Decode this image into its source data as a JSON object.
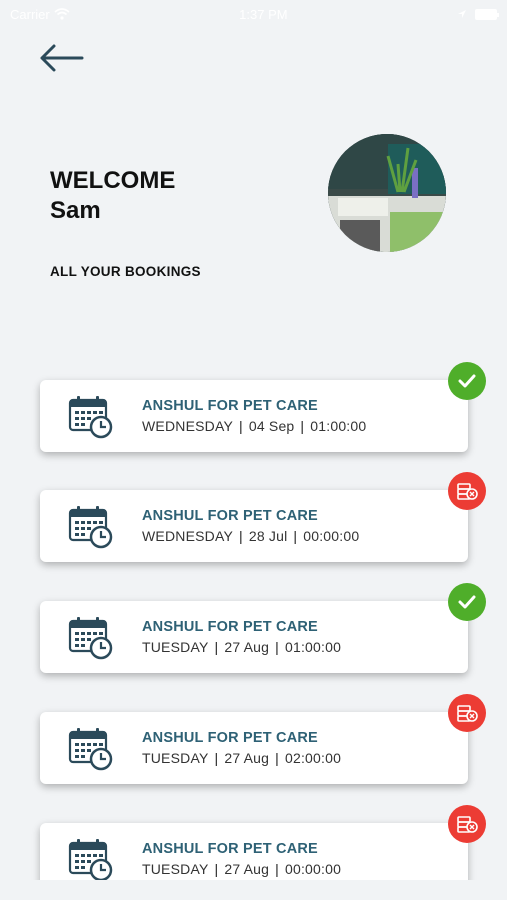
{
  "status_bar": {
    "carrier": "Carrier",
    "time": "1:37 PM"
  },
  "header": {
    "back_icon": "arrow-left-icon",
    "welcome": "WELCOME",
    "user_name": "Sam",
    "subtitle": "ALL YOUR BOOKINGS"
  },
  "colors": {
    "background": "#f1f3f5",
    "title_accent": "#2e6175",
    "status_confirmed": "#4fae2a",
    "status_cancelled": "#ec3c34"
  },
  "bookings": [
    {
      "title": "ANSHUL FOR PET CARE",
      "day": "WEDNESDAY",
      "date": "04 Sep",
      "time": "01:00:00",
      "status": "confirmed",
      "status_icon": "check-icon"
    },
    {
      "title": "ANSHUL FOR PET CARE",
      "day": "WEDNESDAY",
      "date": "28 Jul",
      "time": "00:00:00",
      "status": "cancelled",
      "status_icon": "money-cancel-icon"
    },
    {
      "title": "ANSHUL FOR PET CARE",
      "day": "TUESDAY",
      "date": "27 Aug",
      "time": "01:00:00",
      "status": "confirmed",
      "status_icon": "check-icon"
    },
    {
      "title": "ANSHUL FOR PET CARE",
      "day": "TUESDAY",
      "date": "27 Aug",
      "time": "02:00:00",
      "status": "cancelled",
      "status_icon": "money-cancel-icon"
    },
    {
      "title": "ANSHUL FOR PET CARE",
      "day": "TUESDAY",
      "date": "27 Aug",
      "time": "00:00:00",
      "status": "cancelled",
      "status_icon": "money-cancel-icon"
    }
  ]
}
